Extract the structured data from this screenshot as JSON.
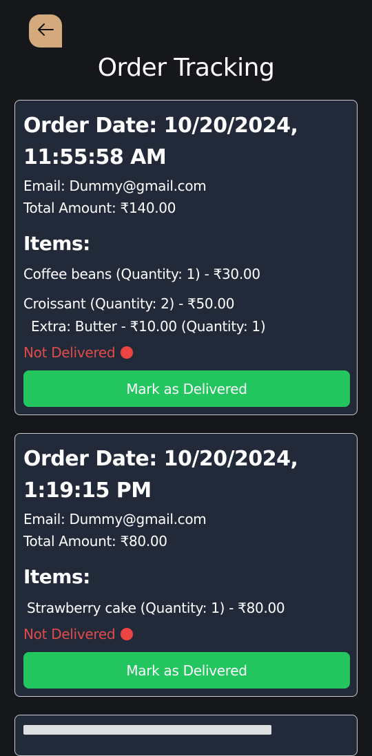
{
  "header": {
    "back_icon": "arrow-left-icon",
    "title": "Order Tracking"
  },
  "orders": [
    {
      "date": "Order Date: 10/20/2024, 11:55:58 AM",
      "email": "Email: Dummy@gmail.com",
      "total": "Total Amount: ₹140.00",
      "items_heading": "Items:",
      "items": [
        {
          "text": "Coffee beans (Quantity: 1) - ₹30.00"
        },
        {
          "text": "Croissant (Quantity: 2) - ₹50.00"
        },
        {
          "text": "Extra: Butter - ₹10.00 (Quantity: 1)"
        }
      ],
      "status": "Not Delivered",
      "status_color": "#e04b4b",
      "button_label": "Mark as Delivered"
    },
    {
      "date": "Order Date: 10/20/2024, 1:19:15 PM",
      "email": "Email: Dummy@gmail.com",
      "total": "Total Amount: ₹80.00",
      "items_heading": "Items:",
      "items": [
        {
          "text": "Strawberry cake (Quantity: 1) - ₹80.00"
        }
      ],
      "status": "Not Delivered",
      "status_color": "#e04b4b",
      "button_label": "Mark as Delivered"
    }
  ],
  "colors": {
    "background": "#16171b",
    "card": "#222a3a",
    "accent_button": "#22c55e",
    "back_button": "#d4a97e"
  }
}
